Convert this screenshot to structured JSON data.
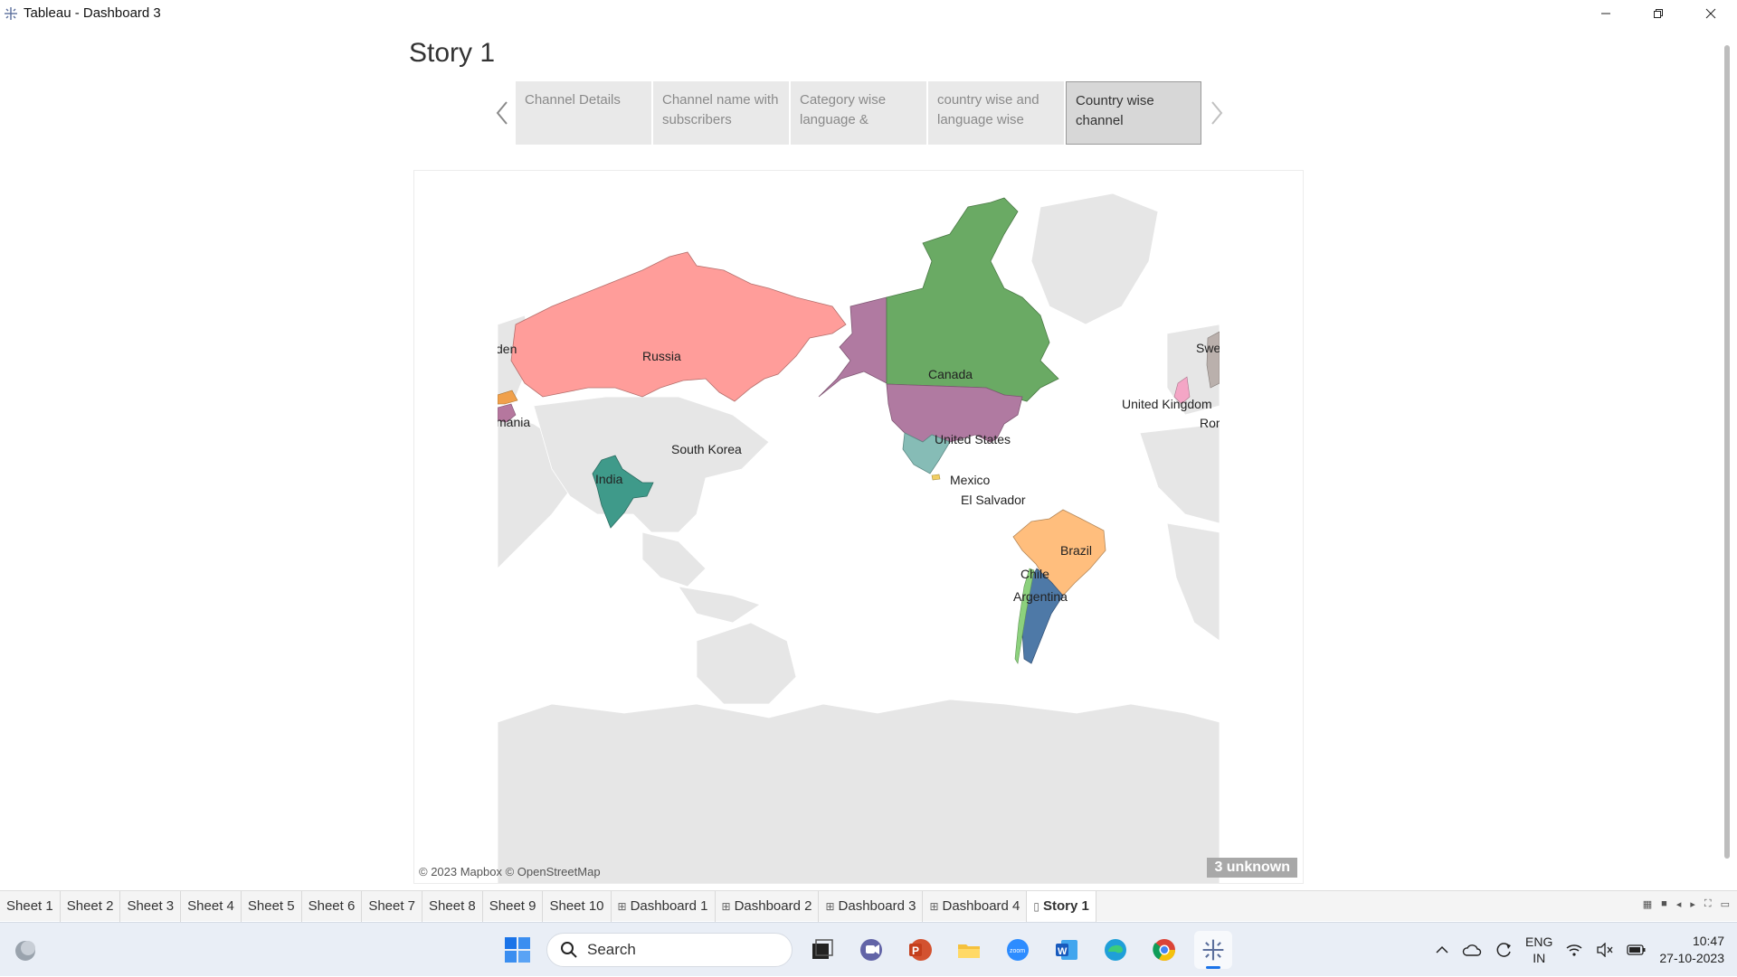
{
  "window": {
    "title": "Tableau - Dashboard 3"
  },
  "story": {
    "title": "Story 1",
    "points": [
      {
        "label": "Channel Details",
        "active": false
      },
      {
        "label": "Channel name with subscribers",
        "active": false
      },
      {
        "label": "Category wise language &",
        "active": false
      },
      {
        "label": "country wise and language wise",
        "active": false
      },
      {
        "label": "Country wise channel",
        "active": true
      }
    ]
  },
  "map": {
    "country_labels": {
      "russia": "Russia",
      "canada": "Canada",
      "united_states": "United States",
      "south_korea": "South Korea",
      "india": "India",
      "mexico": "Mexico",
      "el_salvador": "El Salvador",
      "brazil": "Brazil",
      "chile": "Chile",
      "argentina": "Argentina",
      "united_kingdom": "United Kingdom",
      "sweden_partial_left": "den",
      "romania_partial_left": "mania",
      "sweden_partial_right": "Swe",
      "romania_partial_right": "Ror"
    },
    "colors": {
      "russia": "#ff9d9a",
      "canada": "#6aaa64",
      "united_states": "#b07aa1",
      "india": "#3f9a8a",
      "mexico": "#86bcb6",
      "brazil": "#ffbe7d",
      "argentina": "#4e79a7",
      "chile": "#8cd17d",
      "land": "#e6e6e6"
    },
    "credit": "© 2023 Mapbox © OpenStreetMap",
    "unknown_badge": "3 unknown"
  },
  "sheet_tabs": [
    {
      "label": "Sheet 1",
      "type": "sheet",
      "active": false
    },
    {
      "label": "Sheet 2",
      "type": "sheet",
      "active": false
    },
    {
      "label": "Sheet 3",
      "type": "sheet",
      "active": false
    },
    {
      "label": "Sheet 4",
      "type": "sheet",
      "active": false
    },
    {
      "label": "Sheet 5",
      "type": "sheet",
      "active": false
    },
    {
      "label": "Sheet 6",
      "type": "sheet",
      "active": false
    },
    {
      "label": "Sheet 7",
      "type": "sheet",
      "active": false
    },
    {
      "label": "Sheet 8",
      "type": "sheet",
      "active": false
    },
    {
      "label": "Sheet 9",
      "type": "sheet",
      "active": false
    },
    {
      "label": "Sheet 10",
      "type": "sheet",
      "active": false
    },
    {
      "label": "Dashboard 1",
      "type": "dashboard",
      "active": false
    },
    {
      "label": "Dashboard 2",
      "type": "dashboard",
      "active": false
    },
    {
      "label": "Dashboard 3",
      "type": "dashboard",
      "active": false
    },
    {
      "label": "Dashboard 4",
      "type": "dashboard",
      "active": false
    },
    {
      "label": "Story 1",
      "type": "story",
      "active": true
    }
  ],
  "taskbar": {
    "search_label": "Search",
    "apps": [
      "task-view",
      "teams",
      "powerpoint",
      "file-explorer",
      "zoom",
      "word",
      "edge",
      "chrome",
      "tableau"
    ],
    "lang_line1": "ENG",
    "lang_line2": "IN",
    "time": "10:47",
    "date": "27-10-2023"
  }
}
